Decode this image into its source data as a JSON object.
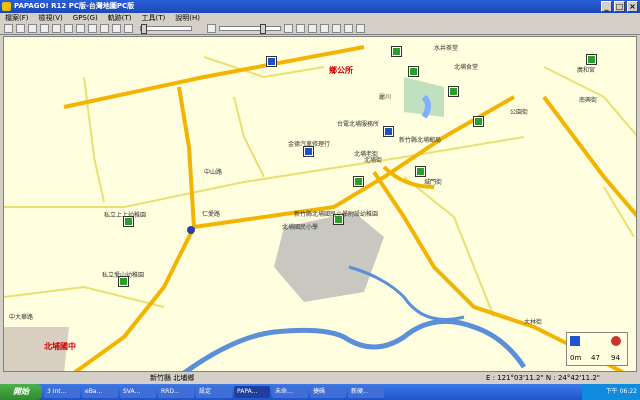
{
  "window": {
    "title": "PAPAGO! R12 PC版-台灣地圖PC版"
  },
  "menu": [
    "檔案(F)",
    "檢視(V)",
    "GPS(G)",
    "軌跡(T)",
    "工具(T)",
    "說明(H)"
  ],
  "map": {
    "labels": {
      "township_office": "鄉公所",
      "school": "北埔國中",
      "roads": [
        "中山路",
        "仁愛路",
        "北埔街",
        "大林街",
        "中大華路",
        "公園街",
        "城門街"
      ],
      "places": [
        "私立上上幼稚園",
        "私立愛山幼稚園",
        "新竹縣北埔國民小學附設幼稚園",
        "北埔國民小學",
        "金德汽車修理行",
        "台電北埔服務所",
        "新竹縣北埔郵局",
        "北埔老街",
        "水井茶堂",
        "北埔食堂",
        "南興街",
        "廣和宮",
        "麗川"
      ]
    }
  },
  "status": {
    "location": "新竹縣 北埔鄉",
    "coord": "E : 121°03'11.2\"  N : 24°42'11.2\"",
    "compass": {
      "scale": "0m",
      "a": "47",
      "b": "94"
    }
  },
  "taskbar": {
    "start": "開始",
    "tasks": [
      "3 Int...",
      "eBa...",
      "SVA...",
      "RRD...",
      "設定",
      "PAPA...",
      "未命...",
      "捷碼",
      "新硬..."
    ],
    "clock": "下午 06:22"
  },
  "colors": {
    "background": "#ffffe0",
    "water": "#5b8fd8",
    "major_road": "#f2b400",
    "minor_road": "#e8e070"
  }
}
